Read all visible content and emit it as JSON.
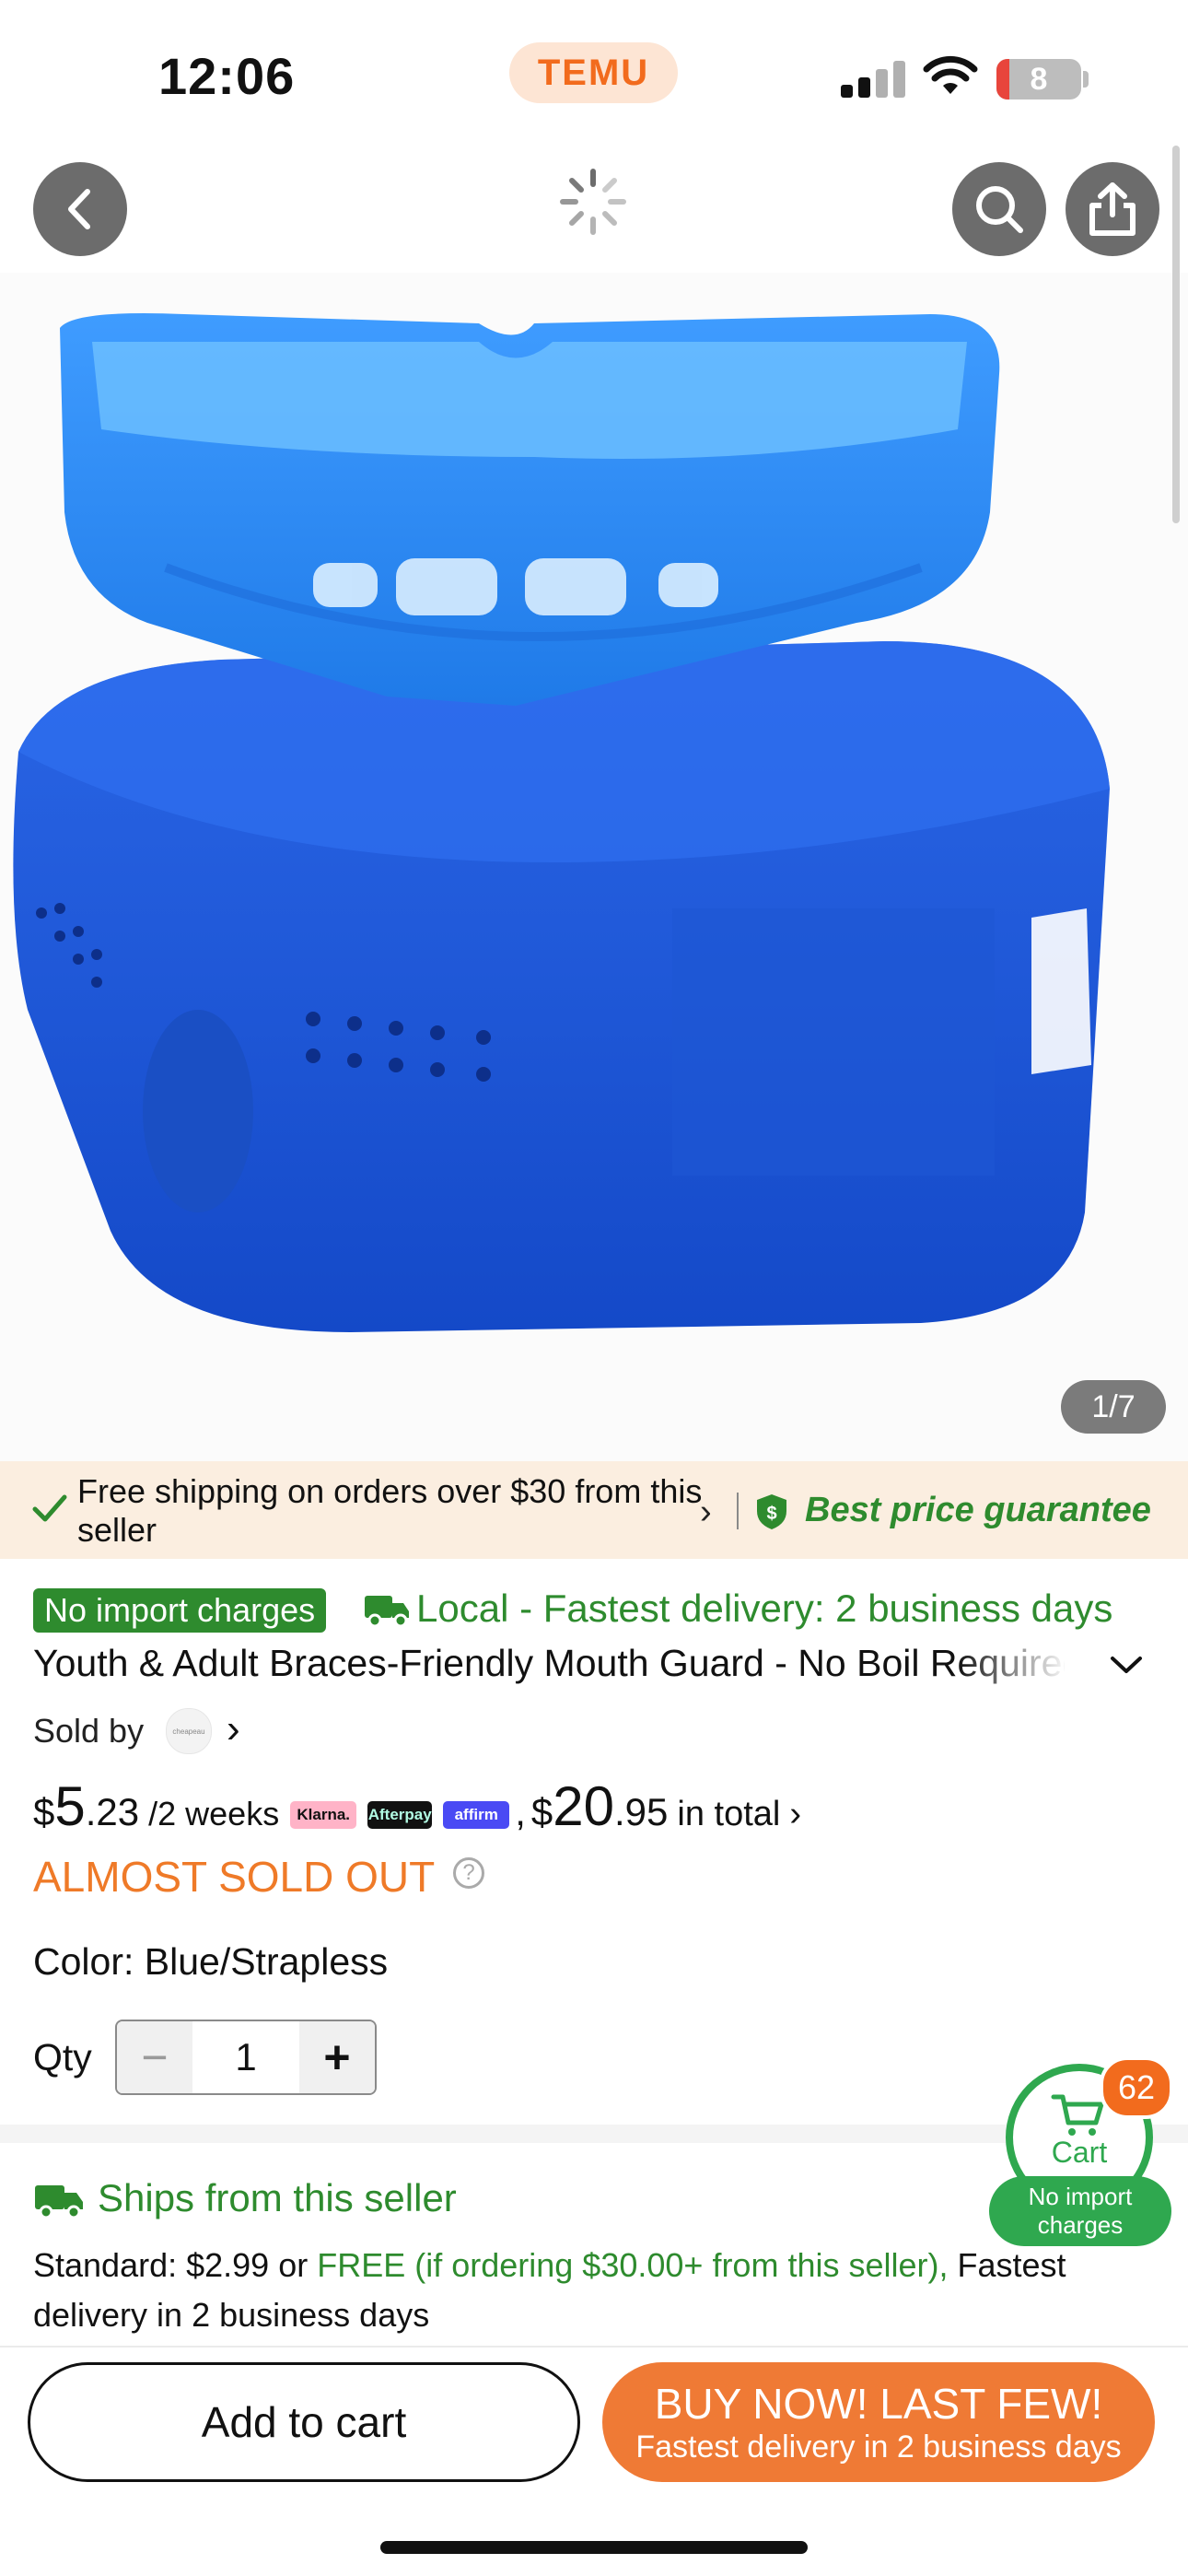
{
  "status_bar": {
    "time": "12:06",
    "app_badge": "TEMU",
    "battery": "8"
  },
  "nav": {
    "back_icon": "chevron-left",
    "loading_icon": "spinner",
    "search_icon": "magnifier",
    "share_icon": "share-up"
  },
  "gallery": {
    "counter": "1/7"
  },
  "promo": {
    "shipping_text": "Free shipping on orders over $30 from this seller",
    "guarantee": "Best price guarantee"
  },
  "product": {
    "badge": "No import charges",
    "delivery": "Local - Fastest delivery: 2 business days",
    "title": "Youth & Adult Braces-Friendly Mouth Guard - No Boil Required",
    "sold_by": "Sold by",
    "seller_logo_text": "cheapeau",
    "installment": {
      "currency": "$",
      "whole": "5",
      "cents": ".23",
      "period": "/2 weeks"
    },
    "payment_logos": [
      "Klarna.",
      "Afterpay",
      "affirm"
    ],
    "total": {
      "prefix": ",",
      "currency": "$",
      "whole": "20",
      "cents": ".95",
      "suffix": "in total"
    },
    "stock_status": "ALMOST SOLD OUT",
    "help_icon": "?",
    "color_label": "Color: Blue/Strapless",
    "qty_label": "Qty",
    "qty_value": "1",
    "qty_minus": "−",
    "qty_plus": "+"
  },
  "shipping": {
    "title": "Ships from this seller",
    "line_prefix": "Standard: $2.99 or ",
    "line_free": "FREE (if ordering $30.00+ from this seller),",
    "line_suffix": " Fastest delivery in 2 business days"
  },
  "cart": {
    "label": "Cart",
    "count": "62",
    "no_import_line1": "No import",
    "no_import_line2": "charges"
  },
  "actions": {
    "add_to_cart": "Add to cart",
    "buy_now": "BUY NOW! LAST FEW!",
    "buy_now_sub": "Fastest delivery in 2 business days"
  },
  "colors": {
    "accent_orange": "#ef7a35",
    "green": "#2e8b2e",
    "cart_green": "#2fa84f",
    "product_blue": "#1f5fe0"
  }
}
